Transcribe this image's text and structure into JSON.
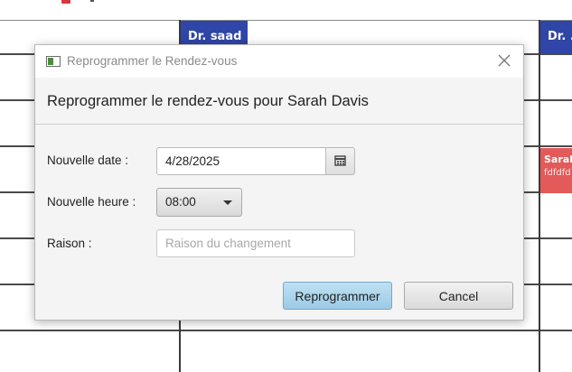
{
  "calendar": {
    "columns": [
      {
        "label": "Dr. saad"
      },
      {
        "label": "Dr. ..."
      }
    ],
    "appointment": {
      "title": "Sarah",
      "subtitle": "fdfdfd"
    }
  },
  "dialog": {
    "window_title": "Reprogrammer le Rendez-vous",
    "header": "Reprogrammer le rendez-vous pour Sarah Davis",
    "fields": {
      "date_label": "Nouvelle date :",
      "date_value": "4/28/2025",
      "time_label": "Nouvelle heure :",
      "time_value": "08:00",
      "reason_label": "Raison :",
      "reason_value": "",
      "reason_placeholder": "Raison du changement"
    },
    "buttons": {
      "confirm": "Reprogrammer",
      "cancel": "Cancel"
    }
  },
  "colors": {
    "column_header": "#2f45a8",
    "appointment": "#e25a5a",
    "primary_button": "#9bcbe6"
  },
  "icons": [
    "close-icon",
    "calendar-icon",
    "chevron-down-icon",
    "app-window-icon"
  ]
}
